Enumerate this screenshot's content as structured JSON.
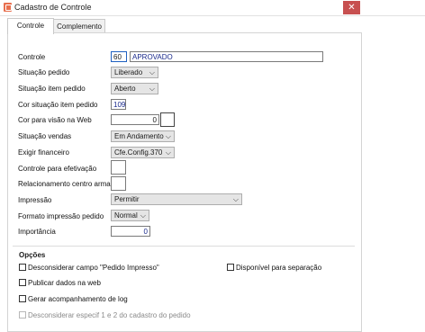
{
  "window": {
    "title": "Cadastro de Controle",
    "close_label": "✕"
  },
  "tabs": [
    {
      "label": "Controle"
    },
    {
      "label": "Complemento"
    }
  ],
  "fields": {
    "controle_label": "Controle",
    "controle_code": "60",
    "controle_desc": "APROVADO",
    "situacao_pedido_label": "Situação pedido",
    "situacao_pedido_value": "Liberado",
    "situacao_item_label": "Situação item pedido",
    "situacao_item_value": "Aberto",
    "cor_situacao_item_label": "Cor situação item pedido",
    "cor_situacao_item_value": "109",
    "cor_visao_web_label": "Cor para visão na Web",
    "cor_visao_web_value": "0",
    "situacao_vendas_label": "Situação vendas",
    "situacao_vendas_value": "Em Andamento",
    "exigir_financeiro_label": "Exigir financeiro",
    "exigir_financeiro_value": "Cfe.Config.370",
    "controle_efetivacao_label": "Controle para efetivação",
    "relacionamento_label": "Relacionamento centro armaz.",
    "impressao_label": "Impressão",
    "impressao_value": "Permitir",
    "formato_impressao_label": "Formato impressão pedido",
    "formato_impressao_value": "Normal",
    "importancia_label": "Importância",
    "importancia_value": "0"
  },
  "options": {
    "title": "Opções",
    "items": [
      {
        "label": "Desconsiderar campo \"Pedido Impresso\"",
        "checked": false,
        "enabled": true
      },
      {
        "label": "Disponível para separação",
        "checked": false,
        "enabled": true
      },
      {
        "label": "Publicar dados na web",
        "checked": false,
        "enabled": true
      },
      {
        "label": "Gerar acompanhamento de log",
        "checked": false,
        "enabled": true
      },
      {
        "label": "Desconsiderar especif 1 e 2 do cadastro do pedido",
        "checked": false,
        "enabled": false
      }
    ]
  },
  "icons": {
    "app": "app-icon",
    "dropdown": "chevron-down-icon"
  },
  "colors": {
    "close": "#c75050",
    "value_text": "#1a2a8c"
  }
}
